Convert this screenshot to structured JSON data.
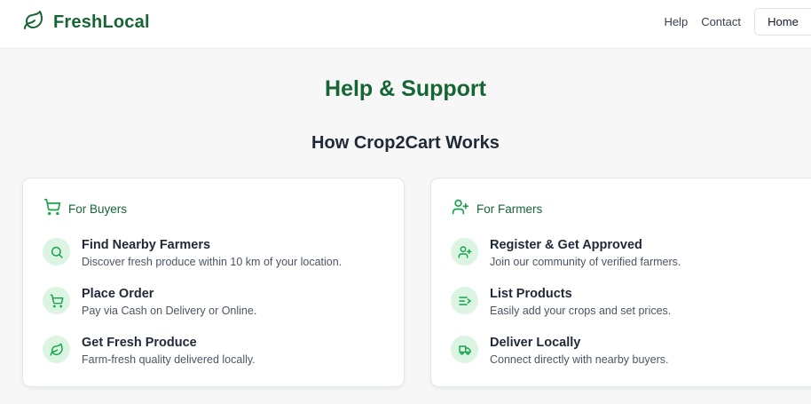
{
  "header": {
    "brand": "FreshLocal",
    "nav": [
      "Help",
      "Contact"
    ],
    "home_label": "Home"
  },
  "main": {
    "title": "Help & Support",
    "subtitle": "How Crop2Cart Works"
  },
  "buyers": {
    "heading": "For Buyers",
    "heading_icon": "shopping-cart-icon",
    "steps": [
      {
        "icon": "search-icon",
        "title": "Find Nearby Farmers",
        "description": "Discover fresh produce within 10 km of your location."
      },
      {
        "icon": "shopping-cart-icon",
        "title": "Place Order",
        "description": "Pay via Cash on Delivery or Online."
      },
      {
        "icon": "leaf-icon",
        "title": "Get Fresh Produce",
        "description": "Farm-fresh quality delivered locally."
      }
    ]
  },
  "farmers": {
    "heading": "For Farmers",
    "heading_icon": "user-plus-icon",
    "steps": [
      {
        "icon": "user-plus-icon",
        "title": "Register & Get Approved",
        "description": "Join our community of verified farmers."
      },
      {
        "icon": "list-plus-icon",
        "title": "List Products",
        "description": "Easily add your crops and set prices."
      },
      {
        "icon": "truck-icon",
        "title": "Deliver Locally",
        "description": "Connect directly with nearby buyers."
      }
    ]
  },
  "colors": {
    "brand_green": "#166534",
    "icon_green": "#16a34a",
    "icon_bg": "#dcf5e3",
    "page_bg": "#f6f7f6"
  }
}
